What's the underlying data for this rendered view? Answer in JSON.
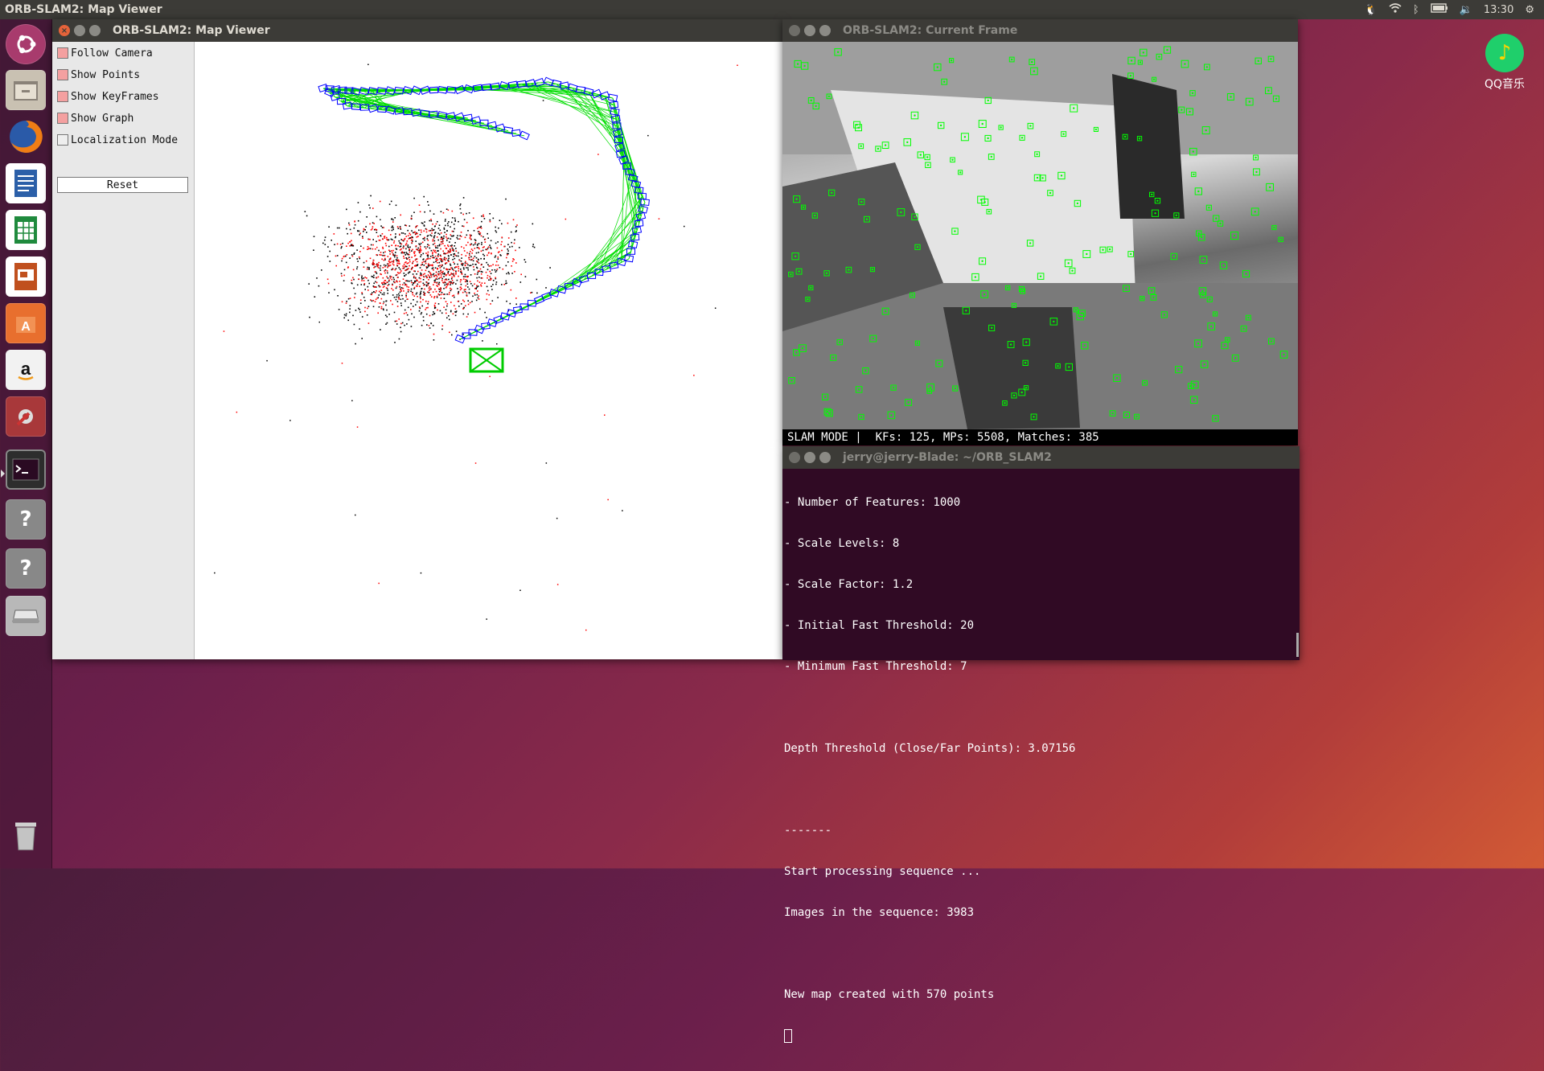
{
  "top_panel": {
    "active_title": "ORB-SLAM2: Map Viewer",
    "clock": "13:30"
  },
  "launcher": {
    "items": [
      "ubuntu-dash",
      "files",
      "firefox",
      "writer",
      "calc",
      "impress",
      "software-center",
      "amazon",
      "system-settings",
      "terminal",
      "unknown-app-1",
      "unknown-app-2",
      "drive",
      "trash"
    ]
  },
  "desktop": {
    "qq_label": "QQ音乐"
  },
  "map_viewer": {
    "title": "ORB-SLAM2: Map Viewer",
    "options": [
      {
        "label": "Follow Camera",
        "checked": true
      },
      {
        "label": "Show Points",
        "checked": true
      },
      {
        "label": "Show KeyFrames",
        "checked": true
      },
      {
        "label": "Show Graph",
        "checked": true
      },
      {
        "label": "Localization Mode",
        "checked": false
      }
    ],
    "reset_label": "Reset"
  },
  "current_frame": {
    "title": "ORB-SLAM2: Current Frame",
    "status": "SLAM MODE |  KFs: 125, MPs: 5508, Matches: 385",
    "feature_color": "#00ff00"
  },
  "terminal": {
    "title": "jerry@jerry-Blade: ~/ORB_SLAM2",
    "lines": [
      "- Number of Features: 1000",
      "- Scale Levels: 8",
      "- Scale Factor: 1.2",
      "- Initial Fast Threshold: 20",
      "- Minimum Fast Threshold: 7",
      "",
      "Depth Threshold (Close/Far Points): 3.07156",
      "",
      "-------",
      "Start processing sequence ...",
      "Images in the sequence: 3983",
      "",
      "New map created with 570 points"
    ]
  },
  "colors": {
    "keyframe": "#0000ff",
    "graph": "#00dd00",
    "map_point": "#000000",
    "reference_point": "#ff0000",
    "current_camera": "#00cc00"
  }
}
